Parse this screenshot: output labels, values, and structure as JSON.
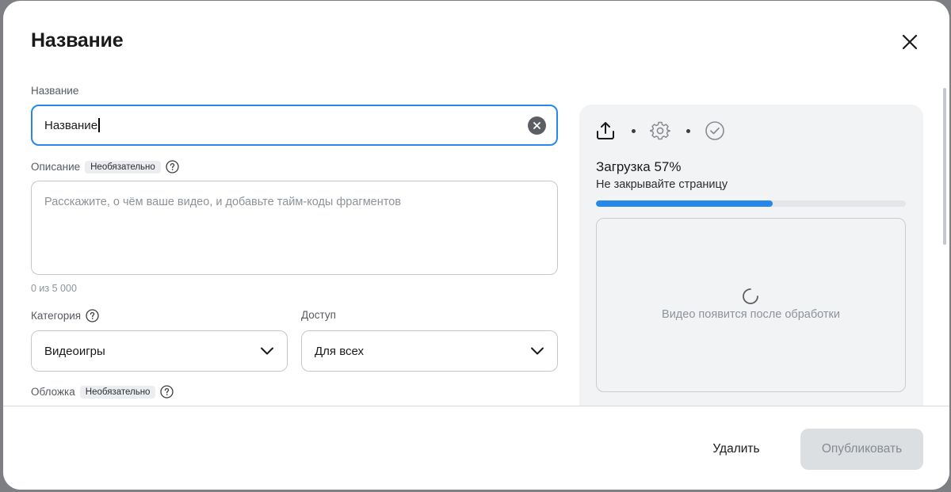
{
  "dialog": {
    "title": "Название"
  },
  "form": {
    "title_field": {
      "label": "Название",
      "value": "Название"
    },
    "description": {
      "label": "Описание",
      "optional_badge": "Необязательно",
      "placeholder": "Расскажите, о чём ваше видео, и добавьте тайм-коды фрагментов",
      "counter": "0 из 5 000"
    },
    "category": {
      "label": "Категория",
      "value": "Видеоигры"
    },
    "access": {
      "label": "Доступ",
      "value": "Для всех"
    },
    "cover": {
      "label": "Обложка",
      "optional_badge": "Необязательно"
    }
  },
  "upload_panel": {
    "steps": [
      "upload-icon",
      "gear-icon",
      "check-circle-icon"
    ],
    "title": "Загрузка 57%",
    "subtitle": "Не закрывайте страницу",
    "progress_percent": 57,
    "preview_text": "Видео появится после обработки"
  },
  "footer": {
    "delete_label": "Удалить",
    "publish_label": "Опубликовать"
  },
  "colors": {
    "accent": "#2688eb",
    "disabled_button": "#dcdfe2",
    "panel_bg": "#f2f3f5"
  }
}
